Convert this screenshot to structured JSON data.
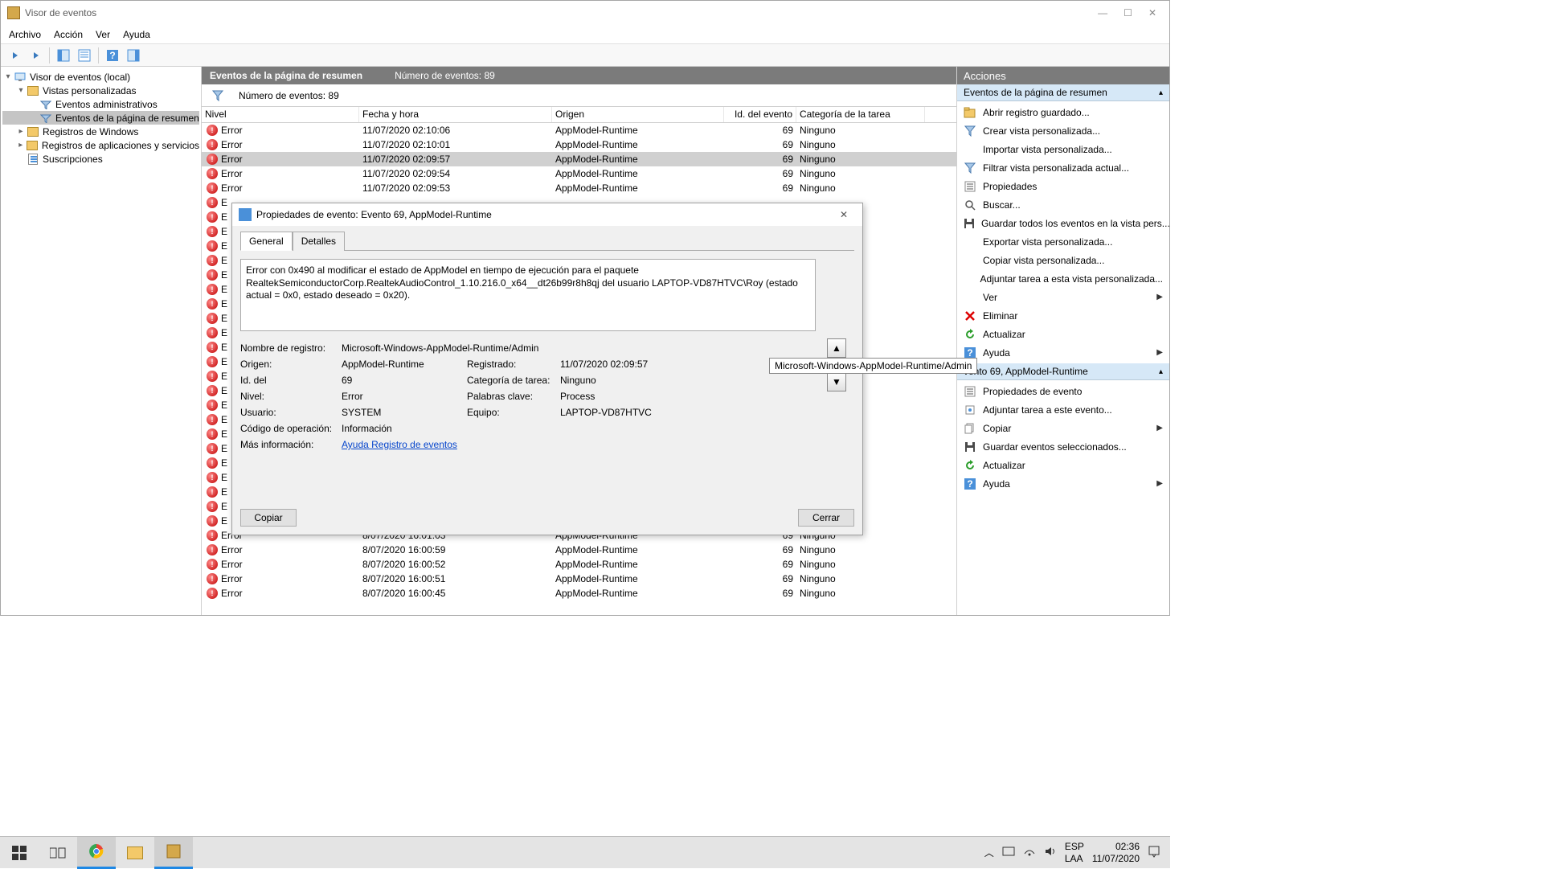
{
  "window": {
    "title": "Visor de eventos",
    "menus": [
      "Archivo",
      "Acción",
      "Ver",
      "Ayuda"
    ]
  },
  "tree": {
    "root": "Visor de eventos (local)",
    "items": [
      {
        "label": "Vistas personalizadas",
        "indent": 1,
        "icon": "folder",
        "expanded": true
      },
      {
        "label": "Eventos administrativos",
        "indent": 2,
        "icon": "view"
      },
      {
        "label": "Eventos de la página de resumen",
        "indent": 2,
        "icon": "view",
        "selected": true
      },
      {
        "label": "Registros de Windows",
        "indent": 1,
        "icon": "folder",
        "expandable": true
      },
      {
        "label": "Registros de aplicaciones y servicios",
        "indent": 1,
        "icon": "folder",
        "expandable": true
      },
      {
        "label": "Suscripciones",
        "indent": 1,
        "icon": "subs"
      }
    ]
  },
  "center": {
    "title": "Eventos de la página de resumen",
    "count_label": "Número de eventos: 89",
    "filter_count": "Número de eventos: 89",
    "columns": {
      "level": "Nivel",
      "date": "Fecha y hora",
      "source": "Origen",
      "id": "Id. del evento",
      "cat": "Categoría de la tarea"
    },
    "rows": [
      {
        "level": "Error",
        "date": "11/07/2020 02:10:06",
        "source": "AppModel-Runtime",
        "id": "69",
        "cat": "Ninguno"
      },
      {
        "level": "Error",
        "date": "11/07/2020 02:10:01",
        "source": "AppModel-Runtime",
        "id": "69",
        "cat": "Ninguno"
      },
      {
        "level": "Error",
        "date": "11/07/2020 02:09:57",
        "source": "AppModel-Runtime",
        "id": "69",
        "cat": "Ninguno",
        "selected": true
      },
      {
        "level": "Error",
        "date": "11/07/2020 02:09:54",
        "source": "AppModel-Runtime",
        "id": "69",
        "cat": "Ninguno"
      },
      {
        "level": "Error",
        "date": "11/07/2020 02:09:53",
        "source": "AppModel-Runtime",
        "id": "69",
        "cat": "Ninguno"
      },
      {
        "level": "E",
        "date": "",
        "source": "",
        "id": "",
        "cat": "",
        "obscured": true
      },
      {
        "level": "E",
        "date": "",
        "source": "",
        "id": "",
        "cat": "",
        "obscured": true
      },
      {
        "level": "E",
        "date": "",
        "source": "",
        "id": "",
        "cat": "",
        "obscured": true
      },
      {
        "level": "E",
        "date": "",
        "source": "",
        "id": "",
        "cat": "",
        "obscured": true
      },
      {
        "level": "E",
        "date": "",
        "source": "",
        "id": "",
        "cat": "",
        "obscured": true
      },
      {
        "level": "E",
        "date": "",
        "source": "",
        "id": "",
        "cat": "",
        "obscured": true
      },
      {
        "level": "E",
        "date": "",
        "source": "",
        "id": "",
        "cat": "",
        "obscured": true
      },
      {
        "level": "E",
        "date": "",
        "source": "",
        "id": "",
        "cat": "",
        "obscured": true
      },
      {
        "level": "E",
        "date": "",
        "source": "",
        "id": "",
        "cat": "",
        "obscured": true
      },
      {
        "level": "E",
        "date": "",
        "source": "",
        "id": "",
        "cat": "",
        "obscured": true
      },
      {
        "level": "E",
        "date": "",
        "source": "",
        "id": "",
        "cat": "",
        "obscured": true
      },
      {
        "level": "E",
        "date": "",
        "source": "",
        "id": "",
        "cat": "",
        "obscured": true
      },
      {
        "level": "E",
        "date": "",
        "source": "",
        "id": "",
        "cat": "",
        "obscured": true
      },
      {
        "level": "E",
        "date": "",
        "source": "",
        "id": "",
        "cat": "",
        "obscured": true
      },
      {
        "level": "E",
        "date": "",
        "source": "",
        "id": "",
        "cat": "",
        "obscured": true
      },
      {
        "level": "E",
        "date": "",
        "source": "",
        "id": "",
        "cat": "",
        "obscured": true
      },
      {
        "level": "E",
        "date": "",
        "source": "",
        "id": "",
        "cat": "",
        "obscured": true
      },
      {
        "level": "E",
        "date": "",
        "source": "",
        "id": "",
        "cat": "",
        "obscured": true
      },
      {
        "level": "E",
        "date": "",
        "source": "",
        "id": "",
        "cat": "",
        "obscured": true
      },
      {
        "level": "E",
        "date": "",
        "source": "",
        "id": "",
        "cat": "",
        "obscured": true
      },
      {
        "level": "E",
        "date": "",
        "source": "",
        "id": "",
        "cat": "",
        "obscured": true
      },
      {
        "level": "E",
        "date": "",
        "source": "",
        "id": "",
        "cat": "",
        "obscured": true
      },
      {
        "level": "E",
        "date": "",
        "source": "",
        "id": "",
        "cat": "",
        "obscured": true
      },
      {
        "level": "Error",
        "date": "8/07/2020 16:01:03",
        "source": "AppModel-Runtime",
        "id": "69",
        "cat": "Ninguno"
      },
      {
        "level": "Error",
        "date": "8/07/2020 16:00:59",
        "source": "AppModel-Runtime",
        "id": "69",
        "cat": "Ninguno"
      },
      {
        "level": "Error",
        "date": "8/07/2020 16:00:52",
        "source": "AppModel-Runtime",
        "id": "69",
        "cat": "Ninguno"
      },
      {
        "level": "Error",
        "date": "8/07/2020 16:00:51",
        "source": "AppModel-Runtime",
        "id": "69",
        "cat": "Ninguno"
      },
      {
        "level": "Error",
        "date": "8/07/2020 16:00:45",
        "source": "AppModel-Runtime",
        "id": "69",
        "cat": "Ninguno"
      }
    ]
  },
  "dialog": {
    "title": "Propiedades de evento: Evento 69, AppModel-Runtime",
    "tabs": {
      "general": "General",
      "details": "Detalles"
    },
    "description": "Error con 0x490 al modificar el estado de AppModel en tiempo de ejecución para el paquete RealtekSemiconductorCorp.RealtekAudioControl_1.10.216.0_x64__dt26b99r8h8qj del usuario LAPTOP-VD87HTVC\\Roy (estado actual = 0x0, estado deseado = 0x20).",
    "labels": {
      "log_name": "Nombre de registro:",
      "source": "Origen:",
      "registered": "Registrado:",
      "id": "Id. del",
      "category": "Categoría de tarea:",
      "level": "Nivel:",
      "keywords": "Palabras clave:",
      "user": "Usuario:",
      "computer": "Equipo:",
      "opcode": "Código de operación:",
      "more_info": "Más información:"
    },
    "values": {
      "log_name": "Microsoft-Windows-AppModel-Runtime/Admin",
      "source": "AppModel-Runtime",
      "registered": "11/07/2020 02:09:57",
      "id": "69",
      "category": "Ninguno",
      "level": "Error",
      "keywords": "Process",
      "user": "SYSTEM",
      "computer": "LAPTOP-VD87HTVC",
      "opcode": "Información",
      "more_info": "Ayuda Registro de eventos"
    },
    "tooltip": "Microsoft-Windows-AppModel-Runtime/Admin",
    "buttons": {
      "copy": "Copiar",
      "close": "Cerrar"
    }
  },
  "actions": {
    "header": "Acciones",
    "group1_title": "Eventos de la página de resumen",
    "group1": [
      {
        "icon": "open",
        "label": "Abrir registro guardado..."
      },
      {
        "icon": "funnel",
        "label": "Crear vista personalizada..."
      },
      {
        "icon": "none",
        "label": "Importar vista personalizada..."
      },
      {
        "icon": "funnel",
        "label": "Filtrar vista personalizada actual..."
      },
      {
        "icon": "props",
        "label": "Propiedades"
      },
      {
        "icon": "search",
        "label": "Buscar..."
      },
      {
        "icon": "save",
        "label": "Guardar todos los eventos en la vista pers..."
      },
      {
        "icon": "none",
        "label": "Exportar vista personalizada..."
      },
      {
        "icon": "none",
        "label": "Copiar vista personalizada..."
      },
      {
        "icon": "none",
        "label": "Adjuntar tarea a esta vista personalizada..."
      },
      {
        "icon": "none",
        "label": "Ver",
        "arrow": true
      },
      {
        "icon": "delete",
        "label": "Eliminar"
      },
      {
        "icon": "refresh",
        "label": "Actualizar"
      },
      {
        "icon": "help",
        "label": "Ayuda",
        "arrow": true
      }
    ],
    "group2_title": "vento 69, AppModel-Runtime",
    "group2": [
      {
        "icon": "props",
        "label": "Propiedades de evento"
      },
      {
        "icon": "attach",
        "label": "Adjuntar tarea a este evento..."
      },
      {
        "icon": "copy",
        "label": "Copiar",
        "arrow": true
      },
      {
        "icon": "save",
        "label": "Guardar eventos seleccionados..."
      },
      {
        "icon": "refresh",
        "label": "Actualizar"
      },
      {
        "icon": "help",
        "label": "Ayuda",
        "arrow": true
      }
    ]
  },
  "taskbar": {
    "lang_top": "ESP",
    "lang_bottom": "LAA",
    "time": "02:36",
    "date": "11/07/2020"
  }
}
